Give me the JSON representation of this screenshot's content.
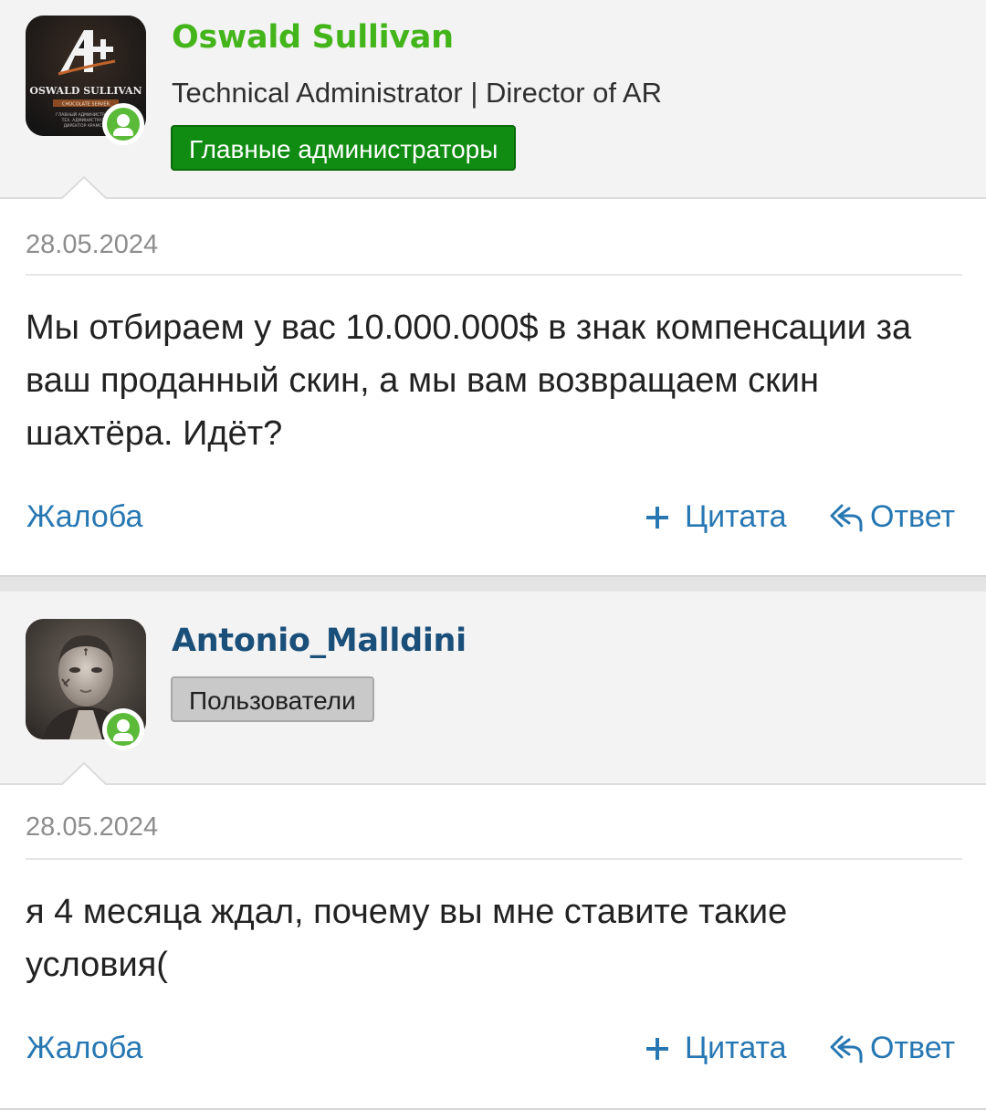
{
  "posts": [
    {
      "author": {
        "name": "Oswald Sullivan",
        "name_color": "#43b51b",
        "title": "Technical Administrator | Director of AR",
        "group": "Главные администраторы",
        "avatar": {
          "logo_text": "OSWALD SULLIVAN",
          "sub_text": "CHOCOLATE SERVER",
          "small_lines": [
            "ГЛАВНЫЙ АДМИНИСТРАТОР",
            "ТЕХ. АДМИНИСТРАТОР",
            "ДИРЕКТОР АРАМСКО"
          ]
        },
        "online": true
      },
      "date": "28.05.2024",
      "message": "Мы отбираем у вас 10.000.000$ в знак компенсации за ваш проданный скин, а мы вам возвращаем скин шахтёра. Идёт?",
      "actions": {
        "report": "Жалоба",
        "quote": "Цитата",
        "reply": "Ответ"
      }
    },
    {
      "author": {
        "name": "Antonio_Malldini",
        "name_color": "#1a4f7a",
        "group": "Пользователи",
        "online": true
      },
      "date": "28.05.2024",
      "message": "я 4 месяца ждал, почему вы мне ставите такие условия(",
      "actions": {
        "report": "Жалоба",
        "quote": "Цитата",
        "reply": "Ответ"
      }
    }
  ],
  "colors": {
    "link": "#2777b3",
    "online": "#5bba38",
    "admin_badge": "#118c12"
  }
}
